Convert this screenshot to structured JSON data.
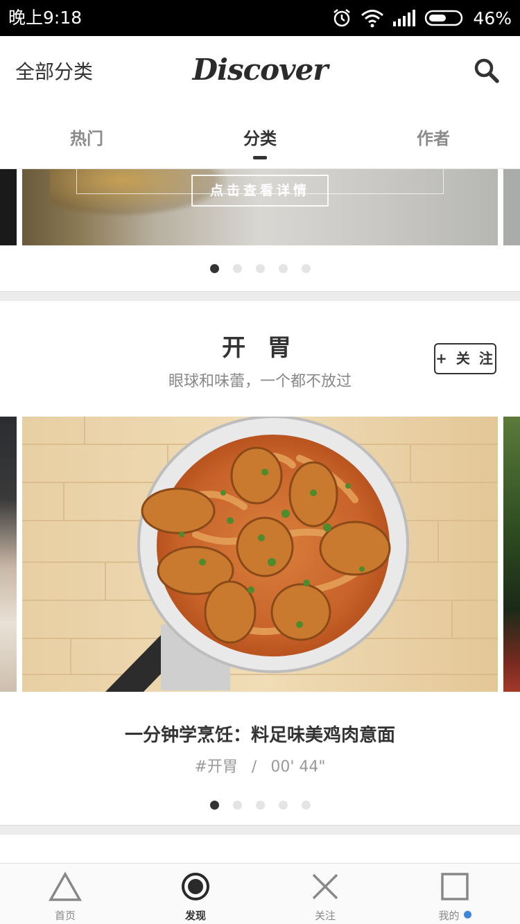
{
  "status_bar": {
    "time": "晚上9:18",
    "battery": "46%",
    "icons": [
      "alarm-icon",
      "wifi-icon",
      "signal-icon",
      "battery-icon"
    ]
  },
  "header": {
    "left_label": "全部分类",
    "logo": "Discover",
    "search_icon": "search-icon"
  },
  "tabs": [
    {
      "label": "热门",
      "active": false
    },
    {
      "label": "分类",
      "active": true
    },
    {
      "label": "作者",
      "active": false
    }
  ],
  "banner": {
    "overlay_text": "点击查看详情",
    "page_index": 1,
    "page_count": 5
  },
  "section": {
    "title": "开 胃",
    "subtitle": "眼球和味蕾，一个都不放过",
    "follow_label": "+ 关 注",
    "card": {
      "title": "一分钟学烹饪：料足味美鸡肉意面",
      "tag": "#开胃",
      "separator": "/",
      "duration": "00' 44\""
    },
    "page_index": 1,
    "page_count": 5
  },
  "bottom_nav": [
    {
      "label": "首页",
      "icon": "triangle-icon",
      "active": false,
      "badge": false
    },
    {
      "label": "发现",
      "icon": "circle-icon",
      "active": true,
      "badge": false
    },
    {
      "label": "关注",
      "icon": "cross-icon",
      "active": false,
      "badge": false
    },
    {
      "label": "我的",
      "icon": "square-icon",
      "active": false,
      "badge": true
    }
  ],
  "colors": {
    "accent_dark": "#333333",
    "badge_blue": "#3d86e0",
    "status_bar": "#000000"
  }
}
